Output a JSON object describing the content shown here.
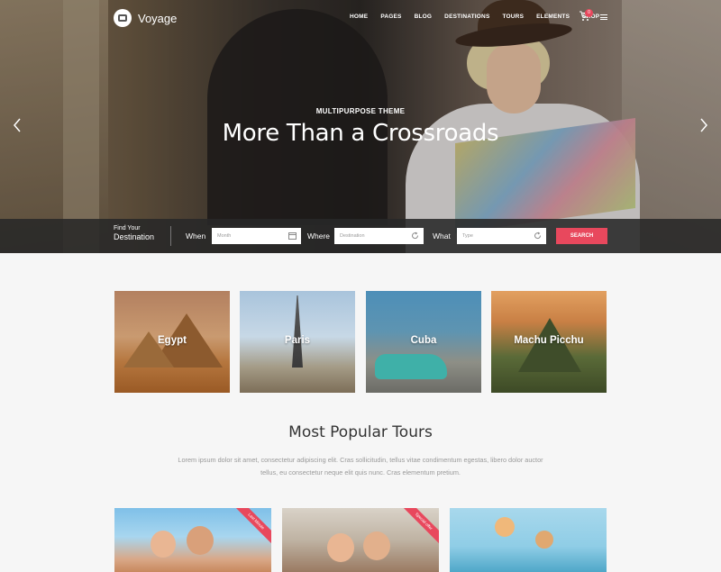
{
  "brand": {
    "name": "Voyage"
  },
  "nav": {
    "items": [
      "HOME",
      "PAGES",
      "BLOG",
      "DESTINATIONS",
      "TOURS",
      "ELEMENTS",
      "SHOP"
    ]
  },
  "cart": {
    "count": "0"
  },
  "hero": {
    "kicker": "MULTIPURPOSE THEME",
    "title": "More Than a Crossroads"
  },
  "search": {
    "find_line1": "Find Your",
    "find_line2": "Destination",
    "when_label": "When",
    "when_placeholder": "Month",
    "where_label": "Where",
    "where_placeholder": "Destination",
    "what_label": "What",
    "what_placeholder": "Type",
    "button": "SEARCH"
  },
  "destinations": [
    {
      "name": "Egypt"
    },
    {
      "name": "Paris"
    },
    {
      "name": "Cuba"
    },
    {
      "name": "Machu Picchu"
    }
  ],
  "popular": {
    "title": "Most Popular Tours",
    "text_line1": "Lorem ipsum dolor sit amet, consectetur adipiscing elit. Cras sollicitudin, tellus vitae condimentum egestas, libero dolor auctor",
    "text_line2": "tellus, eu consectetur neque elit quis nunc. Cras elementum pretium."
  },
  "tours": [
    {
      "ribbon": "Last Minute"
    },
    {
      "ribbon": "Special offer"
    },
    {
      "ribbon": ""
    }
  ],
  "colors": {
    "accent": "#e8485d",
    "searchbar": "#2a2a2a"
  }
}
